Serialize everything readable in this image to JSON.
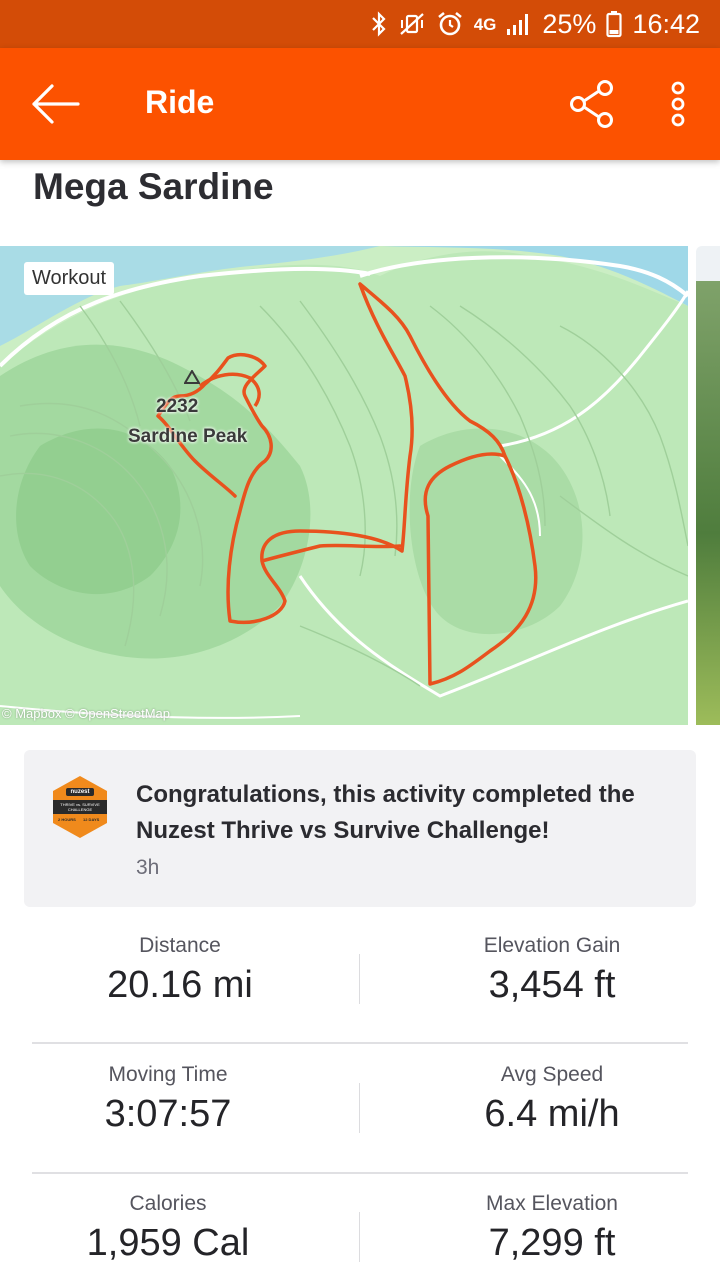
{
  "status_bar": {
    "battery": "25%",
    "time": "16:42",
    "network": "4G"
  },
  "app_bar": {
    "title": "Ride"
  },
  "activity": {
    "title": "Mega Sardine"
  },
  "map": {
    "badge": "Workout",
    "peak_elevation_label": "2232",
    "peak_name_label": "Sardine Peak",
    "attribution": "© Mapbox © OpenStreetMap",
    "route_color": "#e8521e"
  },
  "challenge": {
    "message": "Congratulations, this activity completed the Nuzest Thrive vs Survive Challenge!",
    "time_ago": "3h",
    "badge_brand": "nuzest",
    "badge_title": "THRIVE vs. SURVIVE CHALLENGE",
    "badge_left": "2 HOURS",
    "badge_right": "12 DAYS"
  },
  "stats": [
    {
      "label": "Distance",
      "value": "20.16 mi"
    },
    {
      "label": "Elevation Gain",
      "value": "3,454 ft"
    },
    {
      "label": "Moving Time",
      "value": "3:07:57"
    },
    {
      "label": "Avg Speed",
      "value": "6.4 mi/h"
    },
    {
      "label": "Calories",
      "value": "1,959 Cal"
    },
    {
      "label": "Max Elevation",
      "value": "7,299 ft"
    }
  ],
  "colors": {
    "brand": "#fc5200",
    "status_bar": "#d34c07"
  },
  "icons": {
    "back": "arrow-left-icon",
    "share": "share-icon",
    "more": "more-vertical-icon"
  }
}
